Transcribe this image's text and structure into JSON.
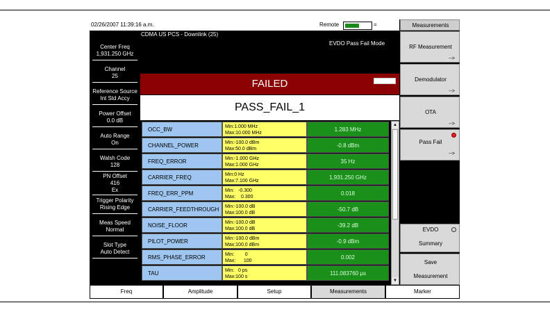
{
  "status": {
    "datetime": "02/26/2007 11:39:16 a.m.",
    "remote_label": "Remote",
    "remote_level": 0.55,
    "remote_tick": "="
  },
  "header": {
    "mode": "CDMA US PCS - Downlink (25)",
    "view": "EVDO Pass Fail Mode"
  },
  "left_panel": [
    {
      "label": "Center Freq",
      "value": "1,931.250 GHz"
    },
    {
      "label": "Channel",
      "value": "25"
    },
    {
      "label": "Reference Source",
      "value": "Int Std Accy"
    },
    {
      "label": "Power Offset",
      "value": "0.0 dB"
    },
    {
      "label": "Auto Range",
      "value": "On"
    },
    {
      "label": "Walsh Code",
      "value": "128"
    },
    {
      "label": "PN Offset",
      "value": "416",
      "value2": "Ex"
    },
    {
      "label": "Trigger Polarity",
      "value": "Rising Edge"
    },
    {
      "label": "Meas Speed",
      "value": "Normal"
    },
    {
      "label": "Slot Type",
      "value": "Auto Detect"
    }
  ],
  "result": {
    "status": "FAILED",
    "test_name": "PASS_FAIL_1"
  },
  "rows": [
    {
      "name": "OCC_BW",
      "limit1": "Min:1.000 MHz",
      "limit2": "Max:10.000 MHz",
      "value": "1.283 MHz"
    },
    {
      "name": "CHANNEL_POWER",
      "limit1": "Min:-100.0 dBm",
      "limit2": "Max:50.0 dBm",
      "value": "-0.8 dBm"
    },
    {
      "name": "FREQ_ERROR",
      "limit1": "Min:-1.000 GHz",
      "limit2": "Max:1.000 GHz",
      "value": "35 Hz"
    },
    {
      "name": "CARRIER_FREQ",
      "limit1": "Min:0 Hz",
      "limit2": "Max:7.100 GHz",
      "value": "1,931.250 GHz"
    },
    {
      "name": "FREQ_ERR_PPM",
      "limit1": "Min:   -0.300",
      "limit2": "Max:    0.300",
      "value": "0.018"
    },
    {
      "name": "CARRIER_FEEDTHROUGH",
      "limit1": "Min:-100.0 dB",
      "limit2": "Max:100.0 dB",
      "value": "-50.7 dB"
    },
    {
      "name": "NOISE_FLOOR",
      "limit1": "Min:-100.0 dB",
      "limit2": "Max:100.0 dB",
      "value": "-39.2 dB"
    },
    {
      "name": "PILOT_POWER",
      "limit1": "Min:-100.0 dBm",
      "limit2": "Max:100.0 dBm",
      "value": "-0.9 dBm"
    },
    {
      "name": "RMS_PHASE_ERROR",
      "limit1": "Min:        0",
      "limit2": "Max:      100",
      "value": "0.002"
    },
    {
      "name": "TAU",
      "limit1": "Min:   0 ps",
      "limit2": "Max:100 s",
      "value": "111.083760 µs"
    }
  ],
  "right_keys": {
    "title": "Measurements",
    "k1": "RF Measurement",
    "k2": "Demodulator",
    "k3": "OTA",
    "k4": "Pass Fail",
    "k5_label": "EVDO",
    "k5_sub": "Summary",
    "k6_line1": "Save",
    "k6_line2": "Measurement",
    "arrow": "-->"
  },
  "bottom_keys": [
    "Freq",
    "Amplitude",
    "Setup",
    "Measurements",
    "Marker"
  ],
  "colors": {
    "failed_bar": "#8b0000",
    "name_cell": "#9ec6f0",
    "limit_cell": "#ffff66",
    "value_cell": "#1a8f1a"
  }
}
